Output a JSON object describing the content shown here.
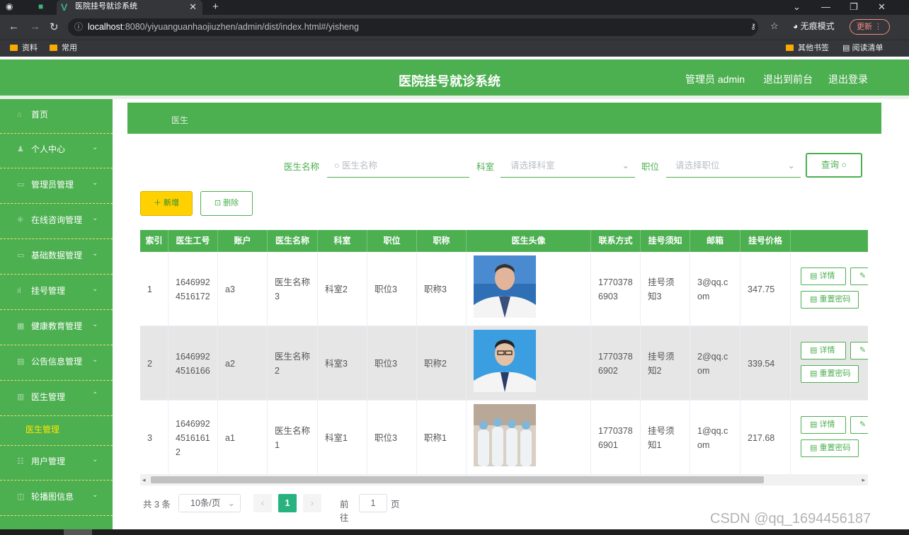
{
  "browser": {
    "tab_title": "医院挂号就诊系统",
    "url_host": "localhost",
    "url_rest": ":8080/yiyuanguanhaojiuzhen/admin/dist/index.html#/yisheng",
    "incognito": "无痕模式",
    "update": "更新",
    "bookmarks": [
      "资料",
      "常用"
    ],
    "other_bookmarks": "其他书签",
    "reading_list": "阅读清单"
  },
  "header": {
    "title": "医院挂号就诊系统",
    "user": "管理员 admin",
    "front": "退出到前台",
    "logout": "退出登录"
  },
  "sidebar": {
    "items": [
      {
        "label": "首页",
        "icon": "home-icon"
      },
      {
        "label": "个人中心",
        "icon": "user-icon"
      },
      {
        "label": "管理员管理",
        "icon": "admin-icon"
      },
      {
        "label": "在线咨询管理",
        "icon": "grid-icon"
      },
      {
        "label": "基础数据管理",
        "icon": "data-icon"
      },
      {
        "label": "挂号管理",
        "icon": "chart-icon"
      },
      {
        "label": "健康教育管理",
        "icon": "book-icon"
      },
      {
        "label": "公告信息管理",
        "icon": "notice-icon"
      },
      {
        "label": "医生管理",
        "icon": "doctor-icon"
      },
      {
        "label": "用户管理",
        "icon": "users-icon"
      },
      {
        "label": "轮播图信息",
        "icon": "image-icon"
      }
    ],
    "active_sub": "医生管理"
  },
  "breadcrumb": "医生",
  "search": {
    "name_label": "医生名称",
    "name_placeholder": "医生名称",
    "dept_label": "科室",
    "dept_placeholder": "请选择科室",
    "pos_label": "职位",
    "pos_placeholder": "请选择职位",
    "query": "查询"
  },
  "actions": {
    "add": "新增",
    "delete": "删除"
  },
  "table": {
    "headers": [
      "索引",
      "医生工号",
      "账户",
      "医生名称",
      "科室",
      "职位",
      "职称",
      "医生头像",
      "联系方式",
      "挂号须知",
      "邮箱",
      "挂号价格",
      ""
    ],
    "rows": [
      {
        "idx": "1",
        "id": "16469924516172",
        "account": "a3",
        "name": "医生名称3",
        "dept": "科室2",
        "pos": "职位3",
        "title": "职称3",
        "phone": "17703786903",
        "notice": "挂号须知3",
        "email": "3@qq.com",
        "price": "347.75"
      },
      {
        "idx": "2",
        "id": "16469924516166",
        "account": "a2",
        "name": "医生名称2",
        "dept": "科室3",
        "pos": "职位3",
        "title": "职称2",
        "phone": "17703786902",
        "notice": "挂号须知2",
        "email": "2@qq.com",
        "price": "339.54"
      },
      {
        "idx": "3",
        "id": "164699245161612",
        "account": "a1",
        "name": "医生名称1",
        "dept": "科室1",
        "pos": "职位3",
        "title": "职称1",
        "phone": "17703786901",
        "notice": "挂号须知1",
        "email": "1@qq.com",
        "price": "217.68"
      }
    ],
    "detail": "详情",
    "reset": "重置密码"
  },
  "pager": {
    "total": "共 3 条",
    "size": "10条/页",
    "current": "1",
    "goto": "前往",
    "goto_val": "1",
    "page_unit": "页"
  },
  "watermark": "CSDN @qq_1694456187"
}
